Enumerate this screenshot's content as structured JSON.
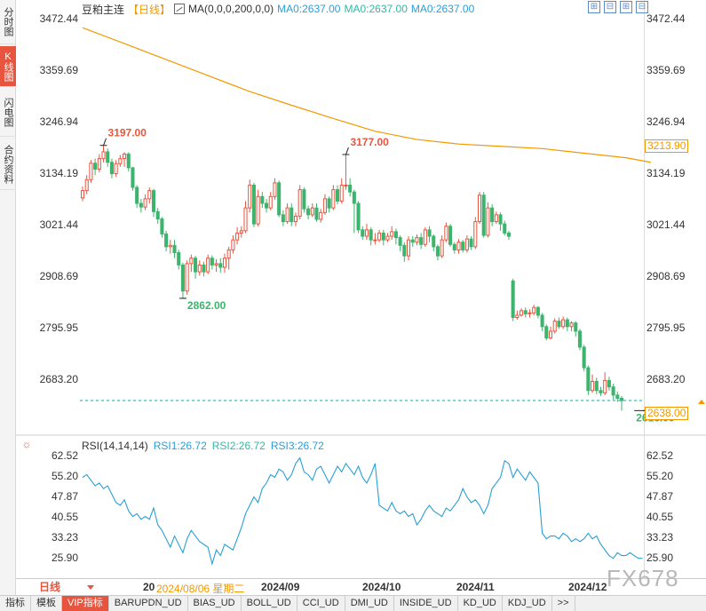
{
  "side_tabs": [
    {
      "label": "分时图",
      "active": false
    },
    {
      "label": "K线图",
      "active": true
    },
    {
      "label": "闪电图",
      "active": false
    },
    {
      "label": "合约资料",
      "active": false
    }
  ],
  "header": {
    "title": "豆粕主连",
    "period": "【日线】",
    "ma_label": "MA(0,0,0,200,0,0)",
    "ma1": "MA0:2637.00",
    "ma2": "MA0:2637.00",
    "ma3": "MA0:2637.00"
  },
  "toolbar": [
    "⊞",
    "⊟",
    "⊞",
    "⊟"
  ],
  "price_axis": [
    "3472.44",
    "3359.69",
    "3246.94",
    "3134.19",
    "3021.44",
    "2908.69",
    "2795.95",
    "2683.20"
  ],
  "price_tags": {
    "ma_value": "3213.90",
    "last_price": "2638.00"
  },
  "annotations": {
    "high1": "3197.00",
    "high2": "3177.00",
    "low1": "2862.00",
    "low2": "2616.00"
  },
  "rsi": {
    "label": "RSI(14,14,14)",
    "rsi1": "RSI1:26.72",
    "rsi2": "RSI2:26.72",
    "rsi3": "RSI3:26.72",
    "axis": [
      "62.52",
      "55.20",
      "47.87",
      "40.55",
      "33.23",
      "25.90"
    ]
  },
  "date_axis": {
    "period": "日线",
    "hover_prefix": "20",
    "hover_date": "2024/08/06 星期二",
    "labels": [
      "2024/09",
      "2024/10",
      "2024/11",
      "2024/12"
    ]
  },
  "watermark": "FX678",
  "bottom_tabs": [
    "指标",
    "模板",
    "VIP指标",
    "BARUPDN_UD",
    "BIAS_UD",
    "BOLL_UD",
    "CCI_UD",
    "DMI_UD",
    "INSIDE_UD",
    "KD_UD",
    "KDJ_UD",
    ">>"
  ],
  "colors": {
    "up": "#e8553f",
    "down": "#3db46d",
    "ma": "#f39800",
    "rsi": "#2a9fd6",
    "dashed": "#1aa5a5"
  },
  "chart_data": {
    "type": "candlestick",
    "y_range": [
      2570,
      3500
    ],
    "candles": [
      [
        3082,
        3098,
        3107,
        3075
      ],
      [
        3098,
        3122,
        3132,
        3090
      ],
      [
        3122,
        3158,
        3165,
        3115
      ],
      [
        3158,
        3145,
        3168,
        3132
      ],
      [
        3145,
        3168,
        3178,
        3138
      ],
      [
        3168,
        3183,
        3197,
        3160
      ],
      [
        3183,
        3160,
        3190,
        3150
      ],
      [
        3160,
        3135,
        3168,
        3125
      ],
      [
        3135,
        3157,
        3165,
        3128
      ],
      [
        3157,
        3168,
        3176,
        3150
      ],
      [
        3168,
        3178,
        3182,
        3150
      ],
      [
        3178,
        3148,
        3182,
        3140
      ],
      [
        3148,
        3105,
        3150,
        3098
      ],
      [
        3105,
        3070,
        3110,
        3060
      ],
      [
        3070,
        3062,
        3080,
        3050
      ],
      [
        3062,
        3080,
        3090,
        3055
      ],
      [
        3080,
        3098,
        3105,
        3070
      ],
      [
        3098,
        3052,
        3102,
        3040
      ],
      [
        3052,
        3036,
        3060,
        3025
      ],
      [
        3036,
        3003,
        3040,
        2995
      ],
      [
        3003,
        2975,
        3010,
        2965
      ],
      [
        2975,
        2978,
        2990,
        2960
      ],
      [
        2978,
        2962,
        2990,
        2950
      ],
      [
        2962,
        2935,
        2968,
        2925
      ],
      [
        2935,
        2878,
        2940,
        2862
      ],
      [
        2878,
        2938,
        2945,
        2870
      ],
      [
        2938,
        2950,
        2958,
        2920
      ],
      [
        2950,
        2920,
        2955,
        2905
      ],
      [
        2920,
        2935,
        2945,
        2912
      ],
      [
        2935,
        2920,
        2942,
        2910
      ],
      [
        2920,
        2950,
        2958,
        2915
      ],
      [
        2950,
        2935,
        2956,
        2925
      ],
      [
        2935,
        2938,
        2948,
        2920
      ],
      [
        2938,
        2930,
        2950,
        2918
      ],
      [
        2930,
        2950,
        2960,
        2918
      ],
      [
        2950,
        2968,
        2975,
        2925
      ],
      [
        2968,
        2990,
        3000,
        2960
      ],
      [
        2990,
        3005,
        3018,
        2980
      ],
      [
        3005,
        3010,
        3020,
        2995
      ],
      [
        3010,
        3060,
        3075,
        3005
      ],
      [
        3060,
        3110,
        3122,
        3050
      ],
      [
        3110,
        3025,
        3115,
        3018
      ],
      [
        3025,
        3085,
        3100,
        3020
      ],
      [
        3085,
        3070,
        3095,
        3060
      ],
      [
        3070,
        3060,
        3080,
        3050
      ],
      [
        3060,
        3085,
        3095,
        3055
      ],
      [
        3085,
        3115,
        3125,
        3078
      ],
      [
        3115,
        3045,
        3120,
        3040
      ],
      [
        3045,
        3030,
        3055,
        3020
      ],
      [
        3030,
        3060,
        3070,
        3025
      ],
      [
        3060,
        3030,
        3070,
        3020
      ],
      [
        3030,
        3042,
        3050,
        3020
      ],
      [
        3042,
        3100,
        3110,
        3035
      ],
      [
        3100,
        3058,
        3105,
        3050
      ],
      [
        3058,
        3045,
        3065,
        3035
      ],
      [
        3045,
        3060,
        3070,
        3040
      ],
      [
        3060,
        3035,
        3070,
        3030
      ],
      [
        3035,
        3050,
        3058,
        3028
      ],
      [
        3050,
        3080,
        3090,
        3045
      ],
      [
        3080,
        3060,
        3085,
        3050
      ],
      [
        3060,
        3100,
        3110,
        3055
      ],
      [
        3100,
        3075,
        3110,
        3068
      ],
      [
        3075,
        3110,
        3125,
        3070
      ],
      [
        3110,
        3110,
        3177,
        3100
      ],
      [
        3110,
        3095,
        3125,
        3085
      ],
      [
        3095,
        3070,
        3100,
        3005
      ],
      [
        3070,
        3012,
        3075,
        3005
      ],
      [
        3012,
        2998,
        3020,
        2990
      ],
      [
        2998,
        3012,
        3025,
        2990
      ],
      [
        3012,
        2990,
        3018,
        2978
      ],
      [
        2990,
        2990,
        3005,
        2980
      ],
      [
        2990,
        3005,
        3012,
        2985
      ],
      [
        3005,
        2990,
        3012,
        2978
      ],
      [
        2990,
        2998,
        3005,
        2985
      ],
      [
        2998,
        3008,
        3020,
        2990
      ],
      [
        3008,
        2995,
        3015,
        2980
      ],
      [
        2995,
        2978,
        3000,
        2965
      ],
      [
        2978,
        2955,
        2985,
        2942
      ],
      [
        2955,
        2990,
        2998,
        2945
      ],
      [
        2990,
        2985,
        2998,
        2975
      ],
      [
        2985,
        2995,
        3002,
        2978
      ],
      [
        2995,
        2980,
        3005,
        2970
      ],
      [
        2980,
        3012,
        3018,
        2975
      ],
      [
        3012,
        2998,
        3020,
        2985
      ],
      [
        2998,
        2975,
        3002,
        2965
      ],
      [
        2975,
        2955,
        2980,
        2945
      ],
      [
        2955,
        2990,
        3000,
        2950
      ],
      [
        2990,
        3020,
        3028,
        2985
      ],
      [
        3020,
        2980,
        3025,
        2975
      ],
      [
        2980,
        2968,
        2985,
        2960
      ],
      [
        2968,
        2985,
        2992,
        2960
      ],
      [
        2985,
        2968,
        2990,
        2962
      ],
      [
        2968,
        2992,
        3000,
        2962
      ],
      [
        2992,
        2975,
        2998,
        2968
      ],
      [
        2975,
        3030,
        3040,
        2970
      ],
      [
        3030,
        3088,
        3095,
        3025
      ],
      [
        3088,
        3000,
        3095,
        2995
      ],
      [
        3000,
        3060,
        3072,
        2995
      ],
      [
        3060,
        3030,
        3068,
        3020
      ],
      [
        3030,
        3045,
        3052,
        3025
      ],
      [
        3045,
        3025,
        3050,
        3010
      ],
      [
        3025,
        3005,
        3032,
        3000
      ],
      [
        3005,
        2998,
        3010,
        2990
      ],
      [
        2900,
        2820,
        2905,
        2812
      ],
      [
        2820,
        2825,
        2835,
        2815
      ],
      [
        2825,
        2835,
        2840,
        2822
      ],
      [
        2835,
        2828,
        2842,
        2820
      ],
      [
        2828,
        2830,
        2838,
        2820
      ],
      [
        2830,
        2842,
        2848,
        2825
      ],
      [
        2842,
        2825,
        2845,
        2818
      ],
      [
        2825,
        2800,
        2830,
        2790
      ],
      [
        2800,
        2775,
        2805,
        2770
      ],
      [
        2775,
        2790,
        2800,
        2772
      ],
      [
        2790,
        2812,
        2818,
        2785
      ],
      [
        2812,
        2800,
        2820,
        2795
      ],
      [
        2800,
        2815,
        2822,
        2795
      ],
      [
        2815,
        2800,
        2820,
        2790
      ],
      [
        2800,
        2808,
        2812,
        2790
      ],
      [
        2808,
        2790,
        2812,
        2778
      ],
      [
        2790,
        2755,
        2795,
        2748
      ],
      [
        2755,
        2710,
        2760,
        2702
      ],
      [
        2710,
        2660,
        2715,
        2650
      ],
      [
        2660,
        2680,
        2695,
        2655
      ],
      [
        2680,
        2660,
        2688,
        2652
      ],
      [
        2660,
        2655,
        2668,
        2648
      ],
      [
        2655,
        2682,
        2700,
        2650
      ],
      [
        2682,
        2668,
        2690,
        2660
      ],
      [
        2668,
        2650,
        2675,
        2640
      ],
      [
        2650,
        2643,
        2658,
        2635
      ],
      [
        2643,
        2638,
        2648,
        2616
      ]
    ],
    "ma_line": [
      [
        0,
        3455
      ],
      [
        10,
        3420
      ],
      [
        20,
        3385
      ],
      [
        30,
        3350
      ],
      [
        40,
        3315
      ],
      [
        50,
        3285
      ],
      [
        60,
        3256
      ],
      [
        70,
        3228
      ],
      [
        80,
        3210
      ],
      [
        90,
        3200
      ],
      [
        100,
        3195
      ],
      [
        110,
        3190
      ],
      [
        120,
        3180
      ],
      [
        130,
        3170
      ],
      [
        136,
        3160
      ]
    ],
    "rsi_range": [
      20,
      66
    ],
    "rsi_values": [
      55,
      56,
      54,
      52,
      53,
      51,
      52,
      49,
      46,
      45,
      47,
      43,
      41,
      42,
      40,
      41,
      40,
      44,
      38,
      36,
      33,
      30,
      34,
      31,
      28,
      33,
      36,
      34,
      32,
      31,
      30,
      24,
      29,
      27,
      31,
      30,
      29,
      33,
      37,
      42,
      45,
      48,
      46,
      51,
      53,
      56,
      55,
      58,
      57,
      54,
      56,
      60,
      62,
      57,
      56,
      54,
      58,
      59,
      56,
      53,
      56,
      59,
      57,
      60,
      58,
      56,
      59,
      55,
      53,
      56,
      60,
      45,
      44,
      43,
      46,
      43,
      42,
      43,
      41,
      42,
      38,
      40,
      43,
      45,
      43,
      42,
      41,
      44,
      43,
      45,
      47,
      51,
      48,
      46,
      47,
      45,
      42,
      45,
      51,
      53,
      55,
      61,
      60,
      55,
      58,
      56,
      54,
      57,
      55,
      53,
      35,
      33,
      34,
      34,
      33,
      35,
      34,
      32,
      33,
      32,
      33,
      35,
      33,
      34,
      31,
      29,
      27,
      26,
      28,
      27,
      27,
      28,
      27,
      26,
      26
    ],
    "x_labels": [
      "2024/09",
      "2024/10",
      "2024/11",
      "2024/12"
    ]
  }
}
